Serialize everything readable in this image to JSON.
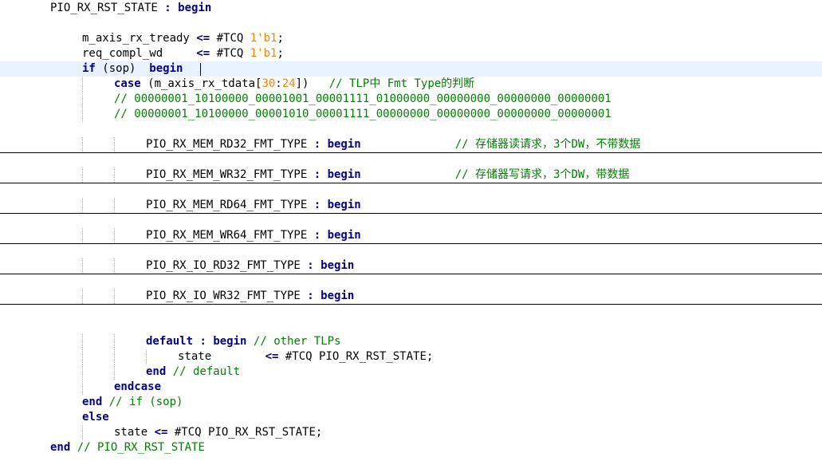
{
  "editor": {
    "lines": [
      {
        "indent": 0,
        "tokens": [
          [
            "id",
            "PIO_RX_RST_STATE "
          ],
          [
            "op",
            ": "
          ],
          [
            "kw",
            "begin"
          ]
        ]
      },
      {
        "indent": 0,
        "tokens": []
      },
      {
        "indent": 1,
        "tokens": [
          [
            "id",
            "m_axis_rx_tready "
          ],
          [
            "op",
            "<= "
          ],
          [
            "id",
            "#TCQ "
          ],
          [
            "num",
            "1'b1"
          ],
          [
            "id",
            ";"
          ]
        ]
      },
      {
        "indent": 1,
        "tokens": [
          [
            "id",
            "req_compl_wd     "
          ],
          [
            "op",
            "<= "
          ],
          [
            "id",
            "#TCQ "
          ],
          [
            "num",
            "1'b1"
          ],
          [
            "id",
            ";"
          ]
        ]
      },
      {
        "indent": 1,
        "current": true,
        "tokens": [
          [
            "kw",
            "if"
          ],
          [
            "id",
            " (sop)  "
          ],
          [
            "kw",
            "begin"
          ]
        ]
      },
      {
        "indent": 2,
        "tokens": [
          [
            "kw",
            "case"
          ],
          [
            "id",
            " (m_axis_rx_tdata["
          ],
          [
            "num",
            "30"
          ],
          [
            "id",
            ":"
          ],
          [
            "num",
            "24"
          ],
          [
            "id",
            "])   "
          ],
          [
            "cm",
            "// TLP中 Fmt Type的判断"
          ]
        ]
      },
      {
        "indent": 2,
        "tokens": [
          [
            "cm",
            "// 00000001_10100000_00001001_00001111_01000000_00000000_00000000_00000001"
          ]
        ]
      },
      {
        "indent": 2,
        "tokens": [
          [
            "cm",
            "// 00000001_10100000_00001010_00001111_00000000_00000000_00000000_00000001"
          ]
        ]
      },
      {
        "indent": 0,
        "tokens": []
      },
      {
        "indent": 3,
        "folded": true,
        "tokens": [
          [
            "id",
            "PIO_RX_MEM_RD32_FMT_TYPE "
          ],
          [
            "op",
            ": "
          ],
          [
            "kw",
            "begin"
          ],
          [
            "id",
            "              "
          ],
          [
            "cm",
            "// 存储器读请求，3个DW，不带数据"
          ]
        ]
      },
      {
        "indent": 0,
        "tokens": []
      },
      {
        "indent": 3,
        "folded": true,
        "tokens": [
          [
            "id",
            "PIO_RX_MEM_WR32_FMT_TYPE "
          ],
          [
            "op",
            ": "
          ],
          [
            "kw",
            "begin"
          ],
          [
            "id",
            "              "
          ],
          [
            "cm",
            "// 存储器写请求，3个DW，带数据"
          ]
        ]
      },
      {
        "indent": 0,
        "tokens": []
      },
      {
        "indent": 3,
        "folded": true,
        "tokens": [
          [
            "id",
            "PIO_RX_MEM_RD64_FMT_TYPE "
          ],
          [
            "op",
            ": "
          ],
          [
            "kw",
            "begin"
          ]
        ]
      },
      {
        "indent": 0,
        "tokens": []
      },
      {
        "indent": 3,
        "folded": true,
        "tokens": [
          [
            "id",
            "PIO_RX_MEM_WR64_FMT_TYPE "
          ],
          [
            "op",
            ": "
          ],
          [
            "kw",
            "begin"
          ]
        ]
      },
      {
        "indent": 0,
        "tokens": []
      },
      {
        "indent": 3,
        "folded": true,
        "tokens": [
          [
            "id",
            "PIO_RX_IO_RD32_FMT_TYPE "
          ],
          [
            "op",
            ": "
          ],
          [
            "kw",
            "begin"
          ]
        ]
      },
      {
        "indent": 0,
        "tokens": []
      },
      {
        "indent": 3,
        "folded": true,
        "tokens": [
          [
            "id",
            "PIO_RX_IO_WR32_FMT_TYPE "
          ],
          [
            "op",
            ": "
          ],
          [
            "kw",
            "begin"
          ]
        ]
      },
      {
        "indent": 0,
        "tokens": []
      },
      {
        "indent": 0,
        "tokens": []
      },
      {
        "indent": 3,
        "tokens": [
          [
            "kw",
            "default"
          ],
          [
            "op",
            " : "
          ],
          [
            "kw",
            "begin"
          ],
          [
            "id",
            " "
          ],
          [
            "cm",
            "// other TLPs"
          ]
        ]
      },
      {
        "indent": 4,
        "tokens": [
          [
            "id",
            "state        "
          ],
          [
            "op",
            "<= "
          ],
          [
            "id",
            "#TCQ PIO_RX_RST_STATE;"
          ]
        ]
      },
      {
        "indent": 3,
        "tokens": [
          [
            "kw",
            "end"
          ],
          [
            "id",
            " "
          ],
          [
            "cm",
            "// default"
          ]
        ]
      },
      {
        "indent": 2,
        "tokens": [
          [
            "kw",
            "endcase"
          ]
        ]
      },
      {
        "indent": 1,
        "tokens": [
          [
            "kw",
            "end"
          ],
          [
            "id",
            " "
          ],
          [
            "cm",
            "// if (sop)"
          ]
        ]
      },
      {
        "indent": 1,
        "tokens": [
          [
            "kw",
            "else"
          ]
        ]
      },
      {
        "indent": 2,
        "tokens": [
          [
            "id",
            "state "
          ],
          [
            "op",
            "<= "
          ],
          [
            "id",
            "#TCQ PIO_RX_RST_STATE;"
          ]
        ]
      },
      {
        "indent": 0,
        "tokens": [
          [
            "kw",
            "end"
          ],
          [
            "id",
            " "
          ],
          [
            "cm",
            "// PIO_RX_RST_STATE"
          ]
        ]
      }
    ]
  }
}
